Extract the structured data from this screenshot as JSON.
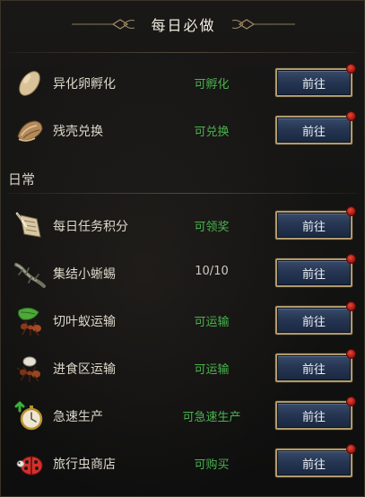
{
  "header": {
    "title": "每日必做"
  },
  "daily_section": {
    "label": "日常"
  },
  "colors": {
    "status_green": "#49b34d",
    "button_blue": "#263653",
    "button_border": "#b09a6e",
    "notify_red": "#c0231a"
  },
  "must_do": [
    {
      "name": "异化卵孵化",
      "status": "可孵化",
      "button": "前往",
      "icon": "egg-icon"
    },
    {
      "name": "残壳兑换",
      "status": "可兑换",
      "button": "前往",
      "icon": "shell-icon"
    }
  ],
  "daily": [
    {
      "name": "每日任务积分",
      "status": "可领奖",
      "button": "前往",
      "icon": "scroll-icon"
    },
    {
      "name": "集结小蜥蜴",
      "status": "10/10",
      "button": "前往",
      "icon": "lizard-icon"
    },
    {
      "name": "切叶蚁运输",
      "status": "可运输",
      "button": "前往",
      "icon": "leafcutter-ant-icon"
    },
    {
      "name": "进食区运输",
      "status": "可运输",
      "button": "前往",
      "icon": "feeding-ant-icon"
    },
    {
      "name": "急速生产",
      "status": "可急速生产",
      "button": "前往",
      "icon": "stopwatch-icon"
    },
    {
      "name": "旅行虫商店",
      "status": "可购买",
      "button": "前往",
      "icon": "ladybug-icon"
    }
  ]
}
